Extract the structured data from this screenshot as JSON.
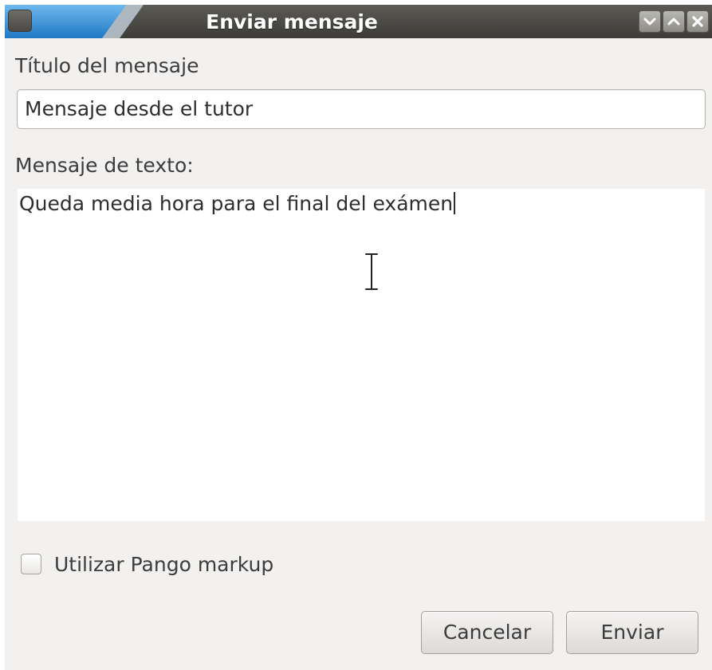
{
  "window": {
    "title": "Enviar mensaje"
  },
  "form": {
    "title_label": "Título del mensaje",
    "title_value": "Mensaje desde el tutor",
    "message_label": "Mensaje de texto:",
    "message_value": "Queda media hora para el final del exámen",
    "pango_label": "Utilizar Pango markup",
    "pango_checked": false
  },
  "buttons": {
    "cancel": "Cancelar",
    "send": "Enviar"
  },
  "icons": {
    "menu": "window-menu-icon",
    "minimize": "minimize-icon",
    "maximize": "maximize-icon",
    "close": "close-icon",
    "cursor": "text-cursor-icon"
  },
  "colors": {
    "titlebar": "#3d3c38",
    "window_bg": "#f2f1f0",
    "accent_wedge": "#2f8fd6"
  }
}
